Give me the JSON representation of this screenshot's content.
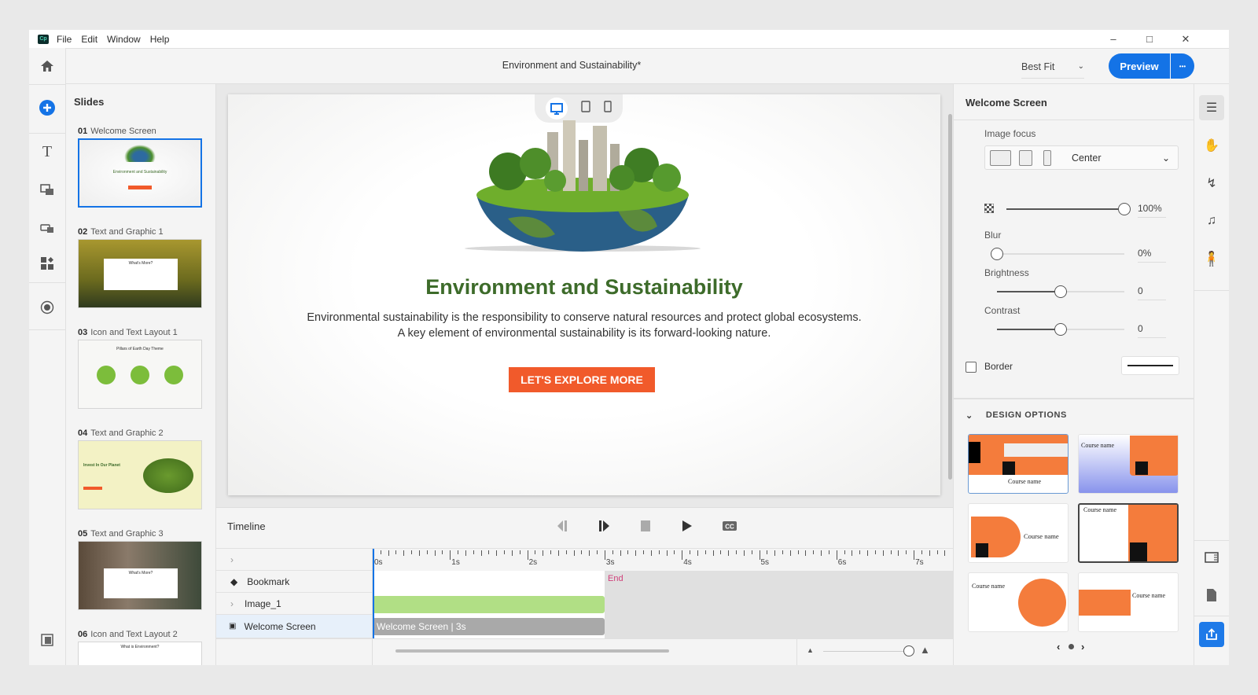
{
  "app": {
    "logo": "Cp",
    "menu": [
      "File",
      "Edit",
      "Window",
      "Help"
    ],
    "window_controls": [
      "minimize",
      "maximize",
      "close"
    ]
  },
  "toolbar": {
    "document_title": "Environment and Sustainability*",
    "zoom_select": "Best Fit",
    "preview_label": "Preview",
    "more_label": "•••"
  },
  "left_rail": {
    "icons": [
      "home-icon",
      "add-icon",
      "text-icon",
      "media-icon",
      "interaction-icon",
      "widgets-icon",
      "record-icon",
      "slide-panel-icon"
    ]
  },
  "slides": {
    "title": "Slides",
    "items": [
      {
        "num": "01",
        "label": "Welcome Screen",
        "thumb_title": "Environment and Sustainability"
      },
      {
        "num": "02",
        "label": "Text and Graphic 1",
        "thumb_title": "What's More?"
      },
      {
        "num": "03",
        "label": "Icon and Text Layout 1",
        "thumb_title": "Pillars of Earth Day Theme"
      },
      {
        "num": "04",
        "label": "Text and Graphic 2",
        "thumb_title": "Invest In Our Planet"
      },
      {
        "num": "05",
        "label": "Text and Graphic 3",
        "thumb_title": "What's More?"
      },
      {
        "num": "06",
        "label": "Icon and Text Layout 2",
        "thumb_title": "What is Environment?"
      }
    ]
  },
  "slide": {
    "heading": "Environment and Sustainability",
    "body": "Environmental sustainability is the responsibility to conserve natural resources and protect global ecosystems. A key element of environmental sustainability is its forward-looking nature.",
    "cta": "LET'S EXPLORE MORE",
    "heading_color": "#3d6b2a",
    "cta_color": "#f15a2b",
    "device_modes": [
      "desktop",
      "tablet",
      "mobile"
    ]
  },
  "timeline": {
    "title": "Timeline",
    "ticks": [
      "0s",
      "1s",
      "2s",
      "3s",
      "4s",
      "5s",
      "6s",
      "7s"
    ],
    "end_label": "End",
    "rows": [
      {
        "label": "Bookmark",
        "icon": "diamond-icon"
      },
      {
        "label": "Image_1",
        "icon": "chevron-right-icon"
      },
      {
        "label": "Welcome Screen",
        "icon": "slide-icon"
      }
    ],
    "clip_label": "Welcome Screen | 3s",
    "duration_s": 3
  },
  "properties": {
    "title": "Welcome Screen",
    "image_focus_label": "Image focus",
    "image_focus_value": "Center",
    "opacity_value": "100%",
    "opacity_pct": 100,
    "blur_label": "Blur",
    "blur_value": "0%",
    "blur_pct": 0,
    "brightness_label": "Brightness",
    "brightness_value": "0",
    "brightness_pct": 50,
    "contrast_label": "Contrast",
    "contrast_value": "0",
    "contrast_pct": 50,
    "border_label": "Border",
    "border_checked": false,
    "design_options_label": "DESIGN OPTIONS",
    "design_course_name": "Course name"
  },
  "colors": {
    "accent": "#1473e6",
    "orange": "#f47c3c",
    "green_clip": "#b1df85",
    "gray_clip": "#a9a9a9"
  }
}
